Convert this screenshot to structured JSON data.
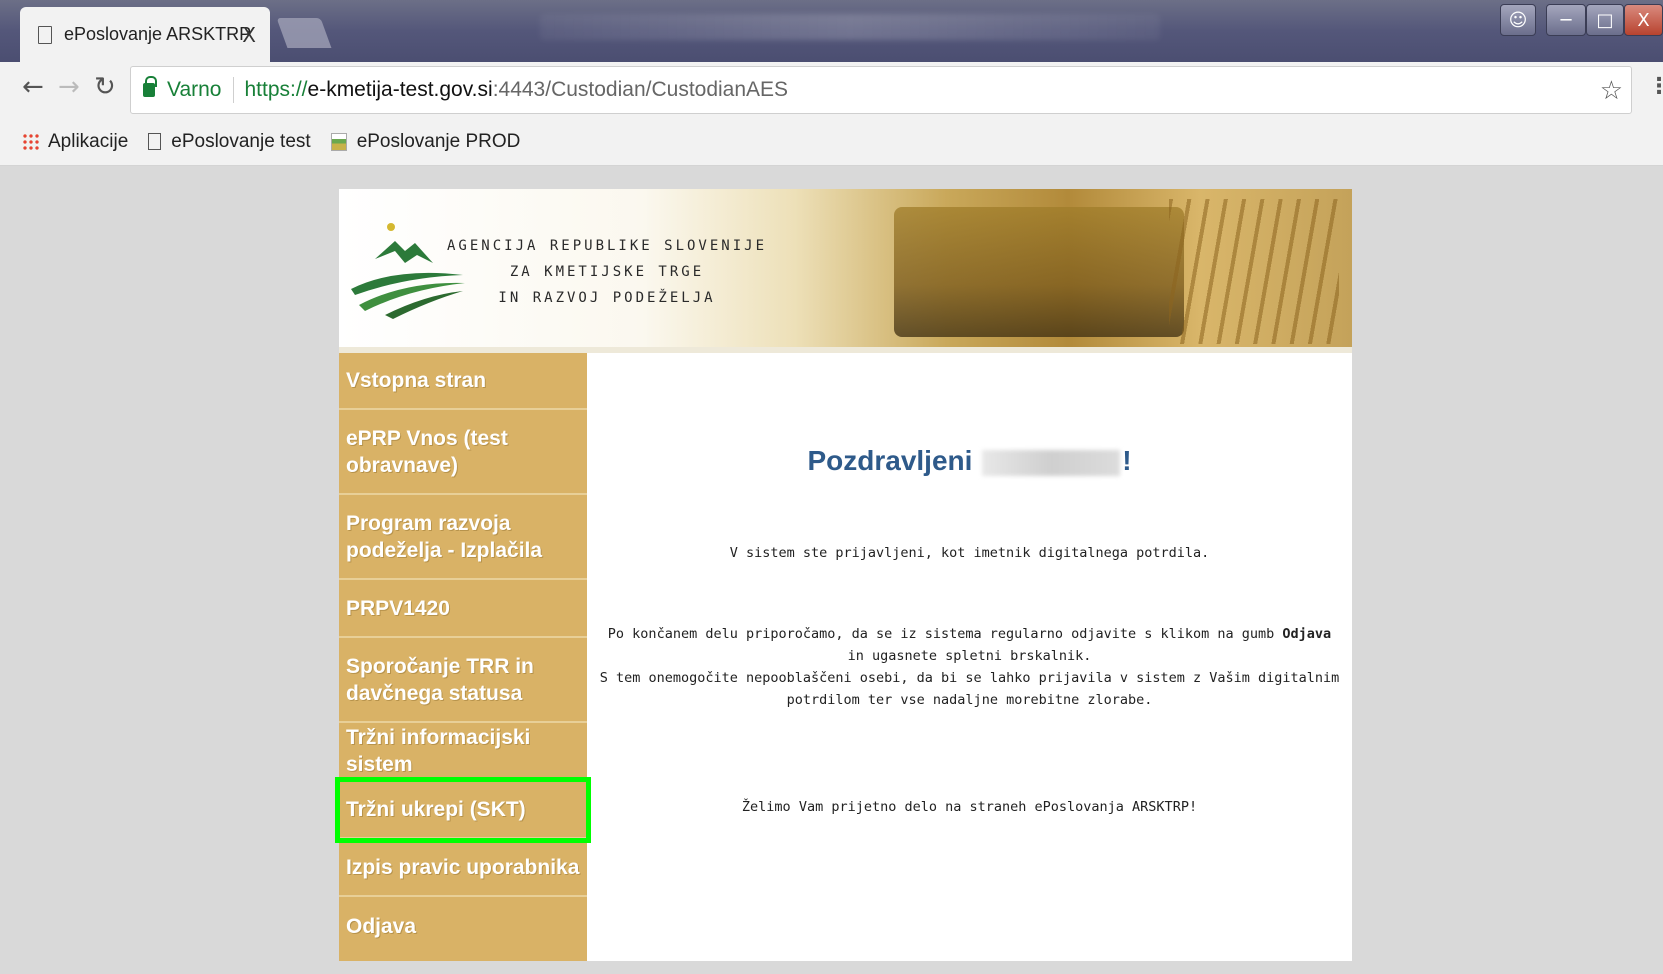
{
  "browser": {
    "tab_title": "ePoslovanje ARSKTRP",
    "tab_close": "X",
    "secure_label": "Varno",
    "url_scheme": "https://",
    "url_host": "e-kmetija-test.gov.si",
    "url_path": ":4443/Custodian/CustodianAES",
    "window_close": "X"
  },
  "bookmarks": [
    {
      "label": "Aplikacije",
      "icon": "apps-icon"
    },
    {
      "label": "ePoslovanje test",
      "icon": "page-icon"
    },
    {
      "label": "ePoslovanje PROD",
      "icon": "favicon"
    }
  ],
  "banner": {
    "line1": "AGENCIJA REPUBLIKE SLOVENIJE",
    "line2": "ZA KMETIJSKE TRGE",
    "line3": "IN RAZVOJ PODEŽELJA"
  },
  "nav": [
    {
      "label": "Vstopna stran"
    },
    {
      "label": "ePRP Vnos (test obravnave)"
    },
    {
      "label": "Program razvoja podeželja - Izplačila"
    },
    {
      "label": "PRPV1420"
    },
    {
      "label": "Sporočanje TRR in davčnega statusa"
    },
    {
      "label": "Tržni informacijski sistem"
    },
    {
      "label": "Tržni ukrepi (SKT)"
    },
    {
      "label": "Izpis pravic uporabnika"
    },
    {
      "label": "Odjava"
    }
  ],
  "content": {
    "greeting_prefix": "Pozdravljeni",
    "greeting_suffix": "!",
    "p1": "V sistem ste prijavljeni, kot imetnik digitalnega potrdila.",
    "p2_before": "Po končanem delu priporočamo, da se iz sistema regularno odjavite s klikom na gumb ",
    "p2_bold": "Odjava",
    "p2_after": " in ugasnete spletni brskalnik.",
    "p3": "S tem onemogočite nepooblaščeni osebi, da bi se lahko prijavila v sistem z Vašim digitalnim potrdilom ter vse nadaljne morebitne zlorabe.",
    "p4": "Želimo Vam prijetno delo na straneh ePoslovanja ARSKTRP!"
  },
  "colors": {
    "sidebar": "#d9b266",
    "greeting": "#2e5a8a",
    "highlight": "#00ff00"
  }
}
